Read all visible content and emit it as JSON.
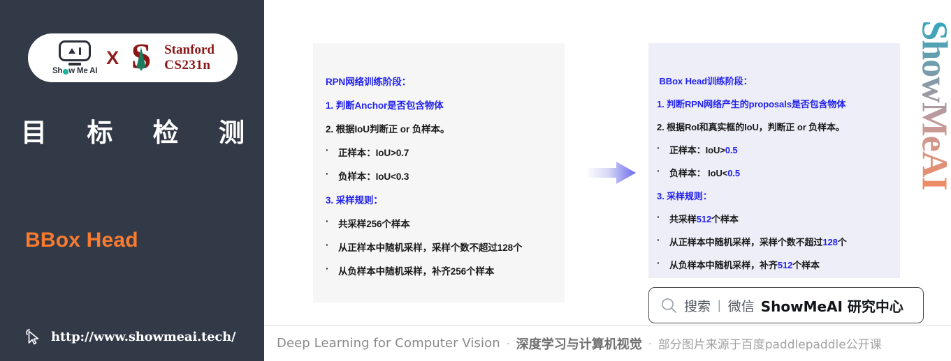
{
  "sidebar": {
    "logo": {
      "showmeai_label": "Show Me AI",
      "x_label": "X",
      "stanford_line1": "Stanford",
      "stanford_line2": "CS231n",
      "stanford_s": "S"
    },
    "title_chars": [
      "目",
      "标",
      "检",
      "测"
    ],
    "subtitle": "BBox Head",
    "url": "http://www.showmeai.tech/",
    "cursor_icon": "cursor-arrow-icon"
  },
  "panel_left": {
    "heading_prefix": "RPN",
    "heading_rest": "网络训练阶段：",
    "items": [
      {
        "text": "1. 判断Anchor是否包含物体",
        "style": "blue",
        "bullet": false
      },
      {
        "text": "2. 根据IoU判断正 or 负样本。",
        "style": "plain",
        "bullet": false
      },
      {
        "text": "正样本：IoU>0.7",
        "style": "plain",
        "bullet": true
      },
      {
        "text": "负样本：IoU<0.3",
        "style": "plain",
        "bullet": true
      },
      {
        "text": "3. 采样规则：",
        "style": "blue",
        "bullet": false
      },
      {
        "text": "共采样256个样本",
        "style": "plain",
        "bullet": true
      },
      {
        "text": "从正样本中随机采样，采样个数不超过128个",
        "style": "plain",
        "bullet": true
      },
      {
        "text": "从负样本中随机采样，补齐256个样本",
        "style": "plain",
        "bullet": true
      }
    ]
  },
  "panel_right": {
    "heading_prefix": "BBox Head",
    "heading_rest": "训练阶段：",
    "items": [
      {
        "pre": "1. 判断RPN网络产生的proposals是否包含物体",
        "hl": "",
        "post": "",
        "style": "blue",
        "bullet": false
      },
      {
        "pre": "2. 根据RoI和真实框的IoU，判断正 or 负样本。",
        "hl": "",
        "post": "",
        "style": "plain",
        "bullet": false
      },
      {
        "pre": "正样本：IoU>",
        "hl": "0.5",
        "post": "",
        "style": "plain",
        "bullet": true
      },
      {
        "pre": "负样本： IoU<",
        "hl": "0.5",
        "post": "",
        "style": "plain",
        "bullet": true
      },
      {
        "pre": "3. 采样规则：",
        "hl": "",
        "post": "",
        "style": "blue",
        "bullet": false
      },
      {
        "pre": "共采样",
        "hl": "512",
        "post": "个样本",
        "style": "plain",
        "bullet": true
      },
      {
        "pre": "从正样本中随机采样，采样个数不超过",
        "hl": "128",
        "post": "个",
        "style": "plain",
        "bullet": true
      },
      {
        "pre": "从负样本中随机采样，补齐",
        "hl": "512",
        "post": "个样本",
        "style": "plain",
        "bullet": true
      }
    ]
  },
  "arrow": {
    "name": "flow-arrow-right"
  },
  "watermark": {
    "text": "ShowMeAI"
  },
  "search": {
    "icon": "magnifier-icon",
    "placeholder": "搜索",
    "separator": "|",
    "channel": "微信",
    "brand": "ShowMeAI 研究中心"
  },
  "footer": {
    "english": "Deep Learning for Computer Vision",
    "dot1": "·",
    "chinese_bold": "深度学习与计算机视觉",
    "dot2": "·",
    "source": "部分图片来源于百度paddlepaddle公开课"
  },
  "colors": {
    "sidebar_bg": "#323a47",
    "accent_orange": "#f97b2f",
    "accent_blue": "#2222ee",
    "stanford_red": "#8c1515",
    "panel_left_bg": "#f6f6f7",
    "panel_right_bg": "#eeeef9"
  }
}
